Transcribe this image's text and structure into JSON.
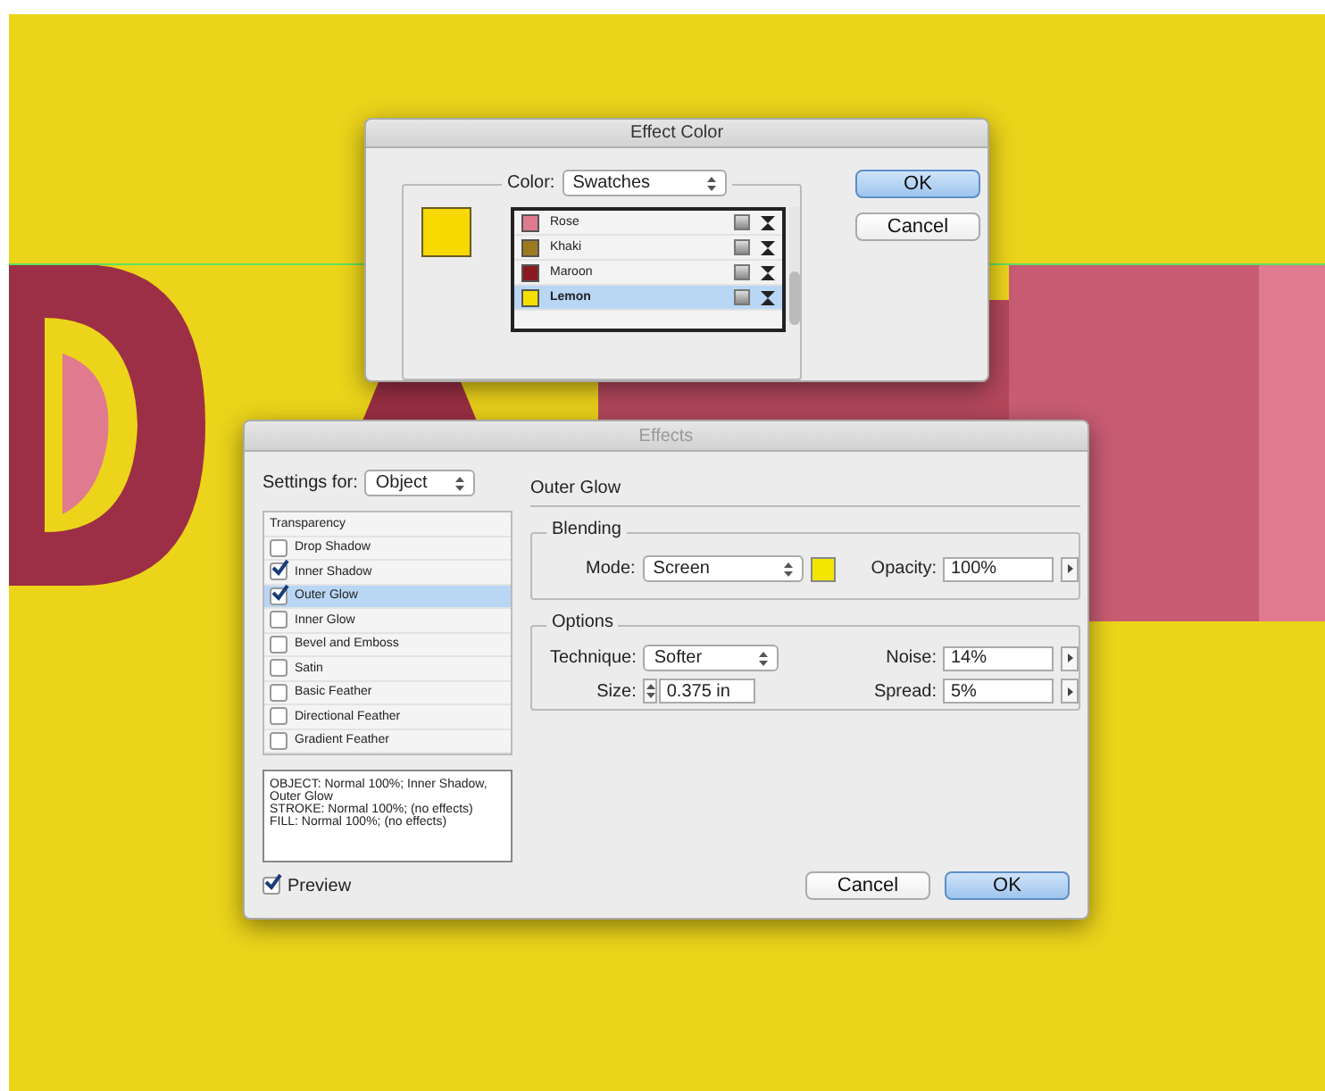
{
  "effect_color_dialog": {
    "title": "Effect Color",
    "color_label": "Color:",
    "color_source": "Swatches",
    "swatches": [
      {
        "name": "Rose",
        "color": "#e07a8f",
        "selected": false
      },
      {
        "name": "Khaki",
        "color": "#9c7a1e",
        "selected": false
      },
      {
        "name": "Maroon",
        "color": "#8a1a22",
        "selected": false
      },
      {
        "name": "Lemon",
        "color": "#f7e000",
        "selected": true
      }
    ],
    "buttons": [
      {
        "label": "OK",
        "default": true
      },
      {
        "label": "Cancel",
        "default": false
      }
    ]
  },
  "effects_dialog": {
    "title": "Effects",
    "settings_for_label": "Settings for:",
    "settings_for": "Object",
    "list_header": "Transparency",
    "effects": [
      {
        "label": "Drop Shadow",
        "checked": false,
        "selected": false
      },
      {
        "label": "Inner Shadow",
        "checked": true,
        "selected": false
      },
      {
        "label": "Outer Glow",
        "checked": true,
        "selected": true
      },
      {
        "label": "Inner Glow",
        "checked": false,
        "selected": false
      },
      {
        "label": "Bevel and Emboss",
        "checked": false,
        "selected": false
      },
      {
        "label": "Satin",
        "checked": false,
        "selected": false
      },
      {
        "label": "Basic Feather",
        "checked": false,
        "selected": false
      },
      {
        "label": "Directional Feather",
        "checked": false,
        "selected": false
      },
      {
        "label": "Gradient Feather",
        "checked": false,
        "selected": false
      }
    ],
    "summary": [
      "OBJECT: Normal 100%; Inner Shadow, Outer Glow",
      "STROKE: Normal 100%; (no effects)",
      "FILL: Normal 100%; (no effects)"
    ],
    "section_title": "Outer Glow",
    "blending": {
      "title": "Blending",
      "mode_label": "Mode:",
      "mode": "Screen",
      "opacity_label": "Opacity:",
      "opacity": "100%"
    },
    "options": {
      "title": "Options",
      "technique_label": "Technique:",
      "technique": "Softer",
      "size_label": "Size:",
      "size": "0.375 in",
      "noise_label": "Noise:",
      "noise": "14%",
      "spread_label": "Spread:",
      "spread": "5%"
    },
    "preview": {
      "label": "Preview",
      "checked": true
    },
    "buttons": [
      {
        "label": "Cancel",
        "default": false
      },
      {
        "label": "OK",
        "default": true
      }
    ]
  }
}
